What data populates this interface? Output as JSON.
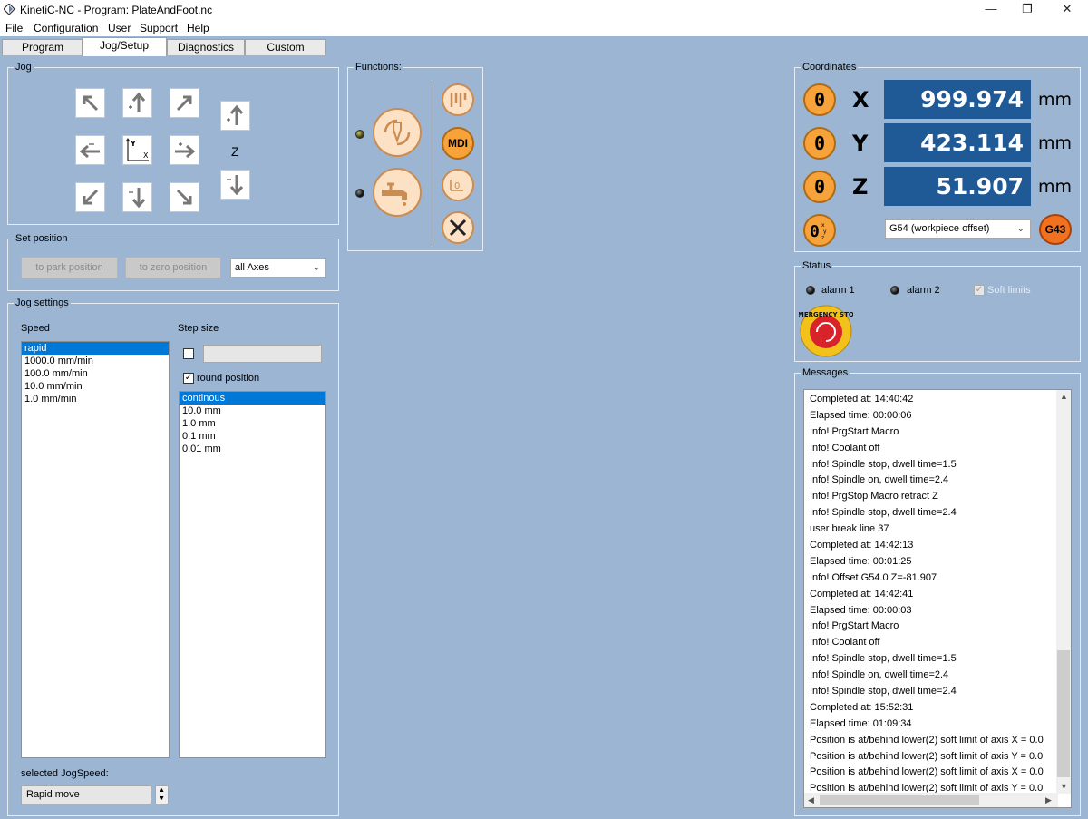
{
  "window": {
    "title": "KinetiC-NC - Program: PlateAndFoot.nc"
  },
  "menu": [
    "File",
    "Configuration",
    "User",
    "Support",
    "Help"
  ],
  "tabs": [
    "Program",
    "Jog/Setup",
    "Diagnostics",
    "Custom"
  ],
  "active_tab": "Jog/Setup",
  "jog": {
    "title": "Jog",
    "z_label": "Z",
    "xy_x": "X",
    "xy_y": "Y"
  },
  "set_position": {
    "title": "Set position",
    "park_button": "to park position",
    "zero_button": "to zero position",
    "axes_select": "all Axes"
  },
  "jog_settings": {
    "title": "Jog settings",
    "speed_label": "Speed",
    "speeds": [
      "rapid",
      "1000.0 mm/min",
      "100.0 mm/min",
      "10.0 mm/min",
      "1.0 mm/min"
    ],
    "speed_selected": 0,
    "step_label": "Step size",
    "step_input": "",
    "round_position": "round position",
    "steps": [
      "continous",
      "10.0 mm",
      "1.0 mm",
      "0.1 mm",
      "0.01 mm"
    ],
    "step_selected": 0,
    "selected_jogspeed_label": "selected JogSpeed:",
    "selected_jogspeed_value": "Rapid move"
  },
  "functions": {
    "title": "Functions:",
    "mdi_label": "MDI"
  },
  "coordinates": {
    "title": "Coordinates",
    "axes": [
      {
        "axis": "X",
        "value": "999.974",
        "unit": "mm"
      },
      {
        "axis": "Y",
        "value": "423.114",
        "unit": "mm"
      },
      {
        "axis": "Z",
        "value": "51.907",
        "unit": "mm"
      }
    ],
    "zero_label": "0",
    "offset_select": "G54 (workpiece offset)",
    "g43_label": "G43",
    "dro_color": "#1f5a96",
    "accent_color": "#f7a33a"
  },
  "status": {
    "title": "Status",
    "alarm1": "alarm 1",
    "alarm2": "alarm 2",
    "soft_limits": "Soft limits",
    "estop_text": "EMERGENCY STOP"
  },
  "messages": {
    "title": "Messages",
    "items": [
      "Completed at: 14:40:42",
      "Elapsed time: 00:00:06",
      "Info! PrgStart Macro",
      "Info! Coolant off",
      "Info! Spindle stop, dwell time=1.5",
      "Info! Spindle on, dwell time=2.4",
      "Info! PrgStop Macro retract Z",
      "Info! Spindle stop, dwell time=2.4",
      "user break line 37",
      "Completed at: 14:42:13",
      "Elapsed time: 00:01:25",
      "Info! Offset G54.0 Z=-81.907",
      "Completed at: 14:42:41",
      "Elapsed time: 00:00:03",
      "Info! PrgStart Macro",
      "Info! Coolant off",
      "Info! Spindle stop, dwell time=1.5",
      "Info! Spindle on, dwell time=2.4",
      "Info! Spindle stop, dwell time=2.4",
      "Completed at: 15:52:31",
      "Elapsed time: 01:09:34",
      "Position is at/behind lower(2) soft limit of axis X = 0.0",
      "Position is at/behind lower(2) soft limit of axis Y = 0.0",
      "Position is at/behind lower(2) soft limit of axis X = 0.0",
      "Position is at/behind lower(2) soft limit of axis Y = 0.0"
    ]
  }
}
